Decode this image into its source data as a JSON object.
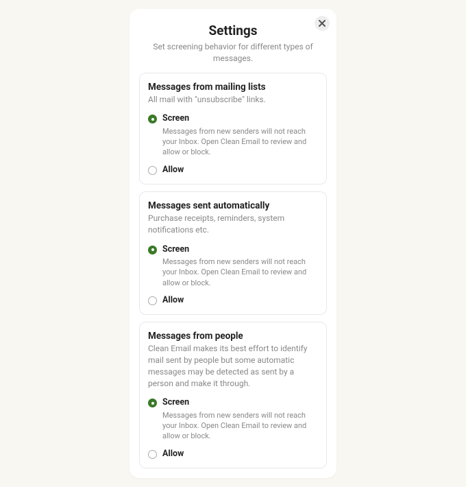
{
  "header": {
    "title": "Settings",
    "subtitle": "Set screening behavior for different types of messages."
  },
  "sections": [
    {
      "id": "mailing-lists",
      "title": "Messages from mailing lists",
      "desc": "All mail with \"unsubscribe\" links.",
      "options": [
        {
          "id": "screen",
          "label": "Screen",
          "desc": "Messages from new senders will not reach your Inbox. Open Clean Email to review and allow or block.",
          "selected": true
        },
        {
          "id": "allow",
          "label": "Allow",
          "desc": "",
          "selected": false
        }
      ]
    },
    {
      "id": "automatic",
      "title": "Messages sent automatically",
      "desc": "Purchase receipts, reminders, system notifications etc.",
      "options": [
        {
          "id": "screen",
          "label": "Screen",
          "desc": "Messages from new senders will not reach your Inbox. Open Clean Email to review and allow or block.",
          "selected": true
        },
        {
          "id": "allow",
          "label": "Allow",
          "desc": "",
          "selected": false
        }
      ]
    },
    {
      "id": "people",
      "title": "Messages from people",
      "desc": "Clean Email makes its best effort to identify mail sent by people but some automatic messages may be detected as sent by a person and make it through.",
      "options": [
        {
          "id": "screen",
          "label": "Screen",
          "desc": "Messages from new senders will not reach your Inbox. Open Clean Email to review and allow or block.",
          "selected": true
        },
        {
          "id": "allow",
          "label": "Allow",
          "desc": "",
          "selected": false
        }
      ]
    }
  ]
}
